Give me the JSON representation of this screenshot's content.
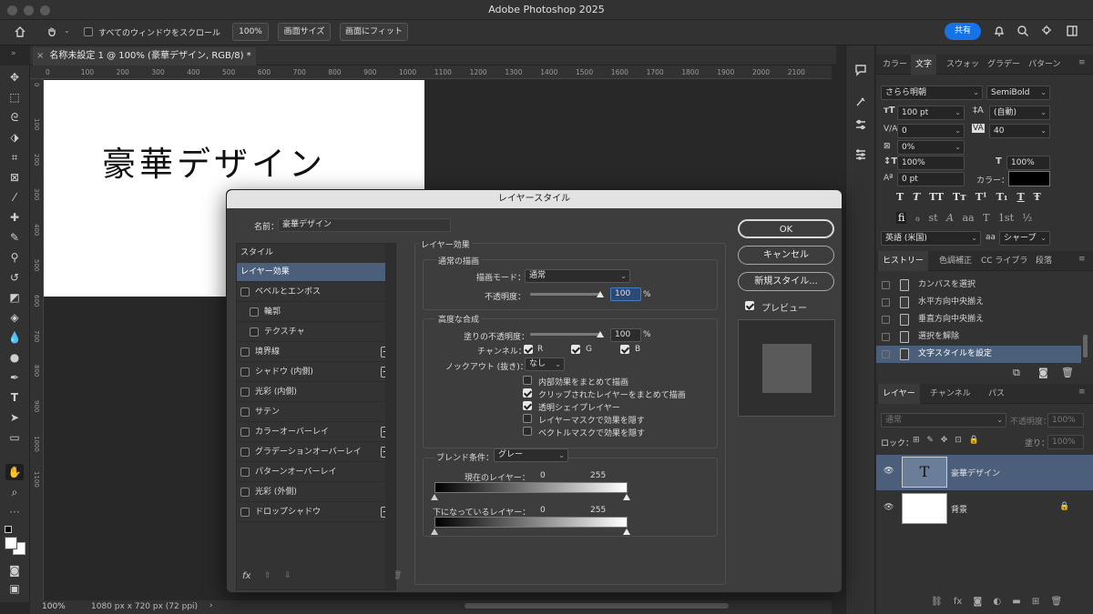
{
  "window": {
    "title": "Adobe Photoshop 2025"
  },
  "options": {
    "scroll_all": "すべてのウィンドウをスクロール",
    "zoom": "100%",
    "fit_screen_size": "画面サイズ",
    "fit_screen": "画面にフィット",
    "share": "共有"
  },
  "document": {
    "tab": "名称未設定 1 @ 100% (豪華デザイン, RGB/8) *",
    "canvas_text": "豪華デザイン"
  },
  "ruler": {
    "h": [
      "0",
      "100",
      "200",
      "300",
      "400",
      "500",
      "600",
      "700",
      "800",
      "900",
      "1000",
      "1100",
      "1200",
      "1300",
      "1400",
      "1500",
      "1600",
      "1700",
      "1800",
      "1900",
      "2000",
      "2100"
    ],
    "v": [
      "0",
      "100",
      "200",
      "300",
      "400",
      "500",
      "600",
      "700",
      "800",
      "900",
      "1000",
      "1100"
    ]
  },
  "status": {
    "zoom": "100%",
    "size": "1080 px x 720 px (72 ppi)",
    "arrow": "›"
  },
  "panels": {
    "top_tabs": [
      "カラー",
      "文字",
      "スウォッ",
      "グラデー",
      "パターン"
    ],
    "char": {
      "font": "さらら明朝",
      "style": "SemiBold",
      "size": "100 pt",
      "leading": "(自動)",
      "kerning": "0",
      "tracking": "40",
      "vscale_pct": "0%",
      "vscale": "100%",
      "hscale": "100%",
      "baseline": "0 pt",
      "color_label": "カラー：",
      "lang": "英語 (米国)",
      "aa_label": "aa",
      "aa": "シャープ",
      "style_btns": [
        "T",
        "T",
        "TT",
        "Tт",
        "T¹",
        "T₁",
        "T",
        "Ŧ"
      ],
      "ot_btns": [
        "fi",
        "ℴ",
        "st",
        "A",
        "aa",
        "T",
        "1st",
        "½"
      ]
    },
    "hist_tabs": [
      "ヒストリー",
      "色調補正",
      "CC ライブラ",
      "段落"
    ],
    "history": [
      "カンバスを選択",
      "水平方向中央揃え",
      "垂直方向中央揃え",
      "選択を解除",
      "文字スタイルを設定"
    ],
    "layer_tabs": [
      "レイヤー",
      "チャンネル",
      "パス"
    ],
    "layers": {
      "mode": "通常",
      "opacity_label": "不透明度：",
      "opacity": "100%",
      "lock_label": "ロック：",
      "fill_label": "塗り：",
      "fill": "100%",
      "items": [
        {
          "name": "豪華デザイン",
          "thumb": "T"
        },
        {
          "name": "背景"
        }
      ]
    }
  },
  "dialog": {
    "title": "レイヤースタイル",
    "name_label": "名前：",
    "name": "豪華デザイン",
    "styles_header": "スタイル",
    "styles": [
      {
        "label": "レイヤー効果",
        "active": true
      },
      {
        "label": "ベベルとエンボス",
        "check": true
      },
      {
        "label": "輪郭",
        "check": true,
        "indent": true
      },
      {
        "label": "テクスチャ",
        "check": true,
        "indent": true
      },
      {
        "label": "境界線",
        "check": true,
        "plus": true
      },
      {
        "label": "シャドウ (内側)",
        "check": true,
        "plus": true
      },
      {
        "label": "光彩 (内側)",
        "check": true
      },
      {
        "label": "サテン",
        "check": true
      },
      {
        "label": "カラーオーバーレイ",
        "check": true,
        "plus": true
      },
      {
        "label": "グラデーションオーバーレイ",
        "check": true,
        "plus": true
      },
      {
        "label": "パターンオーバーレイ",
        "check": true
      },
      {
        "label": "光彩 (外側)",
        "check": true
      },
      {
        "label": "ドロップシャドウ",
        "check": true,
        "plus": true
      }
    ],
    "fx": "fx",
    "effects_title": "レイヤー効果",
    "normal_title": "通常の描画",
    "blend_mode_label": "描画モード：",
    "blend_mode": "通常",
    "opacity_label": "不透明度：",
    "opacity": "100",
    "pct": "%",
    "advanced_title": "高度な合成",
    "fill_opacity_label": "塗りの不透明度：",
    "fill_opacity": "100",
    "channels_label": "チャンネル：",
    "ch_r": "R",
    "ch_g": "G",
    "ch_b": "B",
    "knockout_label": "ノックアウト (抜き)：",
    "knockout": "なし",
    "opts": [
      {
        "label": "内部効果をまとめて描画",
        "on": false
      },
      {
        "label": "クリップされたレイヤーをまとめて描画",
        "on": true
      },
      {
        "label": "透明シェイプレイヤー",
        "on": true
      },
      {
        "label": "レイヤーマスクで効果を隠す",
        "on": false
      },
      {
        "label": "ベクトルマスクで効果を隠す",
        "on": false
      }
    ],
    "blendif_label": "ブレンド条件：",
    "blendif": "グレー",
    "this_layer": "現在のレイヤー：",
    "under_layer": "下になっているレイヤー：",
    "min": "0",
    "max": "255",
    "ok": "OK",
    "cancel": "キャンセル",
    "new_style": "新規スタイル...",
    "preview": "プレビュー"
  }
}
